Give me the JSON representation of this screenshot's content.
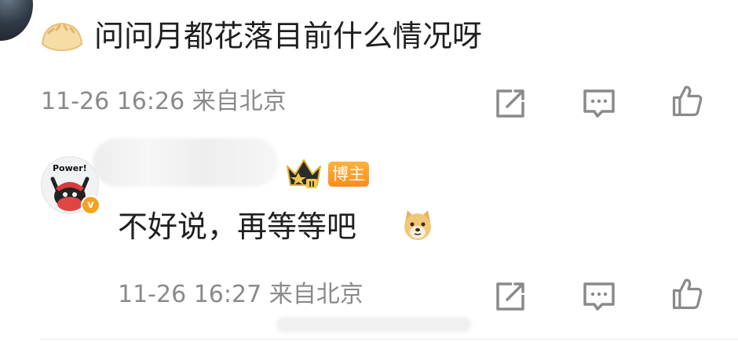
{
  "comment": {
    "text": "问问月都花落目前什么情况呀",
    "emoji": "dumpling-emoji",
    "time": "11-26 16:26",
    "location": "来自北京",
    "actions": [
      "share-icon",
      "reply-icon",
      "like-icon"
    ]
  },
  "reply": {
    "avatar_text": "Power!",
    "verified_mark": "v",
    "crown_level": "II",
    "badge_label": "博主",
    "text": "不好说，再等等吧",
    "emoji": "doge-emoji",
    "time": "11-26 16:27",
    "location": "来自北京",
    "actions": [
      "share-icon",
      "reply-icon",
      "like-icon"
    ]
  },
  "colors": {
    "meta_text": "#8a8a8a",
    "badge_orange": "#ff8c1a",
    "verified_orange": "#f4a31c",
    "icon_gray": "#8a8a8a"
  }
}
